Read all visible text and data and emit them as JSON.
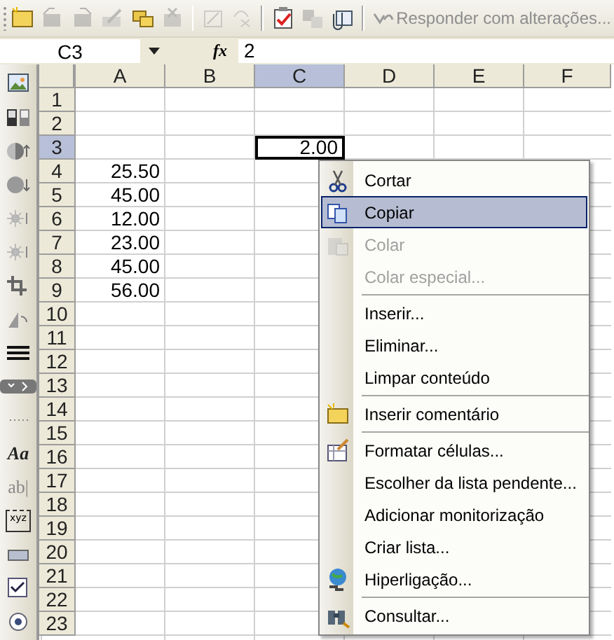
{
  "toolbar": {
    "items": [
      {
        "kind": "new-comment",
        "disabled": false
      },
      {
        "kind": "previous",
        "disabled": true
      },
      {
        "kind": "next",
        "disabled": true
      },
      {
        "kind": "edit",
        "disabled": true
      },
      {
        "kind": "show-all",
        "disabled": false
      },
      {
        "kind": "delete",
        "disabled": true
      },
      {
        "kind": "separator"
      },
      {
        "kind": "ink",
        "disabled": true
      },
      {
        "kind": "delete-ink",
        "disabled": true
      },
      {
        "kind": "separator"
      },
      {
        "kind": "track",
        "disabled": false
      },
      {
        "kind": "pages",
        "disabled": true
      },
      {
        "kind": "mail",
        "disabled": false
      },
      {
        "kind": "separator"
      }
    ],
    "reply_button": {
      "label": "Responder com alterações...",
      "disabled": true
    }
  },
  "formula_bar": {
    "name_box": "C3",
    "fx": "fx",
    "value": "2"
  },
  "side_toolbar": [
    {
      "kind": "picture"
    },
    {
      "kind": "bars"
    },
    {
      "kind": "circle-up"
    },
    {
      "kind": "circle-down"
    },
    {
      "kind": "sun-up"
    },
    {
      "kind": "sun-down"
    },
    {
      "kind": "crop"
    },
    {
      "kind": "triangle"
    },
    {
      "kind": "lines"
    },
    {
      "kind": "handle"
    },
    {
      "kind": "grip"
    },
    {
      "kind": "label",
      "label": "Aa"
    },
    {
      "kind": "label",
      "label": "ab|"
    },
    {
      "kind": "frame",
      "label": "xyz"
    },
    {
      "kind": "button"
    },
    {
      "kind": "checkbox"
    },
    {
      "kind": "radio"
    }
  ],
  "sheet": {
    "columns": [
      {
        "label": "A",
        "selected": false
      },
      {
        "label": "B",
        "selected": false
      },
      {
        "label": "C",
        "selected": true
      },
      {
        "label": "D",
        "selected": false
      },
      {
        "label": "E",
        "selected": false
      },
      {
        "label": "F",
        "selected": false
      }
    ],
    "rows": [
      {
        "label": "1",
        "selected": false,
        "cells": [
          {},
          {},
          {},
          {},
          {},
          {}
        ]
      },
      {
        "label": "2",
        "selected": false,
        "cells": [
          {},
          {},
          {},
          {},
          {},
          {}
        ]
      },
      {
        "label": "3",
        "selected": true,
        "cells": [
          {},
          {},
          {
            "value": "2.00",
            "active": true
          },
          {},
          {},
          {}
        ]
      },
      {
        "label": "4",
        "selected": false,
        "cells": [
          {
            "value": "25.50"
          },
          {},
          {},
          {},
          {},
          {}
        ]
      },
      {
        "label": "5",
        "selected": false,
        "cells": [
          {
            "value": "45.00"
          },
          {},
          {},
          {},
          {},
          {}
        ]
      },
      {
        "label": "6",
        "selected": false,
        "cells": [
          {
            "value": "12.00"
          },
          {},
          {},
          {},
          {},
          {}
        ]
      },
      {
        "label": "7",
        "selected": false,
        "cells": [
          {
            "value": "23.00"
          },
          {},
          {},
          {},
          {},
          {}
        ]
      },
      {
        "label": "8",
        "selected": false,
        "cells": [
          {
            "value": "45.00"
          },
          {},
          {},
          {},
          {},
          {}
        ]
      },
      {
        "label": "9",
        "selected": false,
        "cells": [
          {
            "value": "56.00"
          },
          {},
          {},
          {},
          {},
          {}
        ]
      },
      {
        "label": "10",
        "selected": false,
        "cells": [
          {},
          {},
          {},
          {},
          {},
          {}
        ]
      },
      {
        "label": "11",
        "selected": false,
        "cells": [
          {},
          {},
          {},
          {},
          {},
          {}
        ]
      },
      {
        "label": "12",
        "selected": false,
        "cells": [
          {},
          {},
          {},
          {},
          {},
          {}
        ]
      },
      {
        "label": "13",
        "selected": false,
        "cells": [
          {},
          {},
          {},
          {},
          {},
          {}
        ]
      },
      {
        "label": "14",
        "selected": false,
        "cells": [
          {},
          {},
          {},
          {},
          {},
          {}
        ]
      },
      {
        "label": "15",
        "selected": false,
        "cells": [
          {},
          {},
          {},
          {},
          {},
          {}
        ]
      },
      {
        "label": "16",
        "selected": false,
        "cells": [
          {},
          {},
          {},
          {},
          {},
          {}
        ]
      },
      {
        "label": "17",
        "selected": false,
        "cells": [
          {},
          {},
          {},
          {},
          {},
          {}
        ]
      },
      {
        "label": "18",
        "selected": false,
        "cells": [
          {},
          {},
          {},
          {},
          {},
          {}
        ]
      },
      {
        "label": "19",
        "selected": false,
        "cells": [
          {},
          {},
          {},
          {},
          {},
          {}
        ]
      },
      {
        "label": "20",
        "selected": false,
        "cells": [
          {},
          {},
          {},
          {},
          {},
          {}
        ]
      },
      {
        "label": "21",
        "selected": false,
        "cells": [
          {},
          {},
          {},
          {},
          {},
          {}
        ]
      },
      {
        "label": "22",
        "selected": false,
        "cells": [
          {},
          {},
          {},
          {},
          {},
          {}
        ]
      },
      {
        "label": "23",
        "selected": false,
        "cells": [
          {},
          {},
          {},
          {},
          {},
          {}
        ]
      }
    ]
  },
  "context_menu": [
    {
      "kind": "cut",
      "label": "Cortar",
      "disabled": false,
      "selected": false
    },
    {
      "kind": "copy",
      "label": "Copiar",
      "disabled": false,
      "selected": true
    },
    {
      "kind": "paste",
      "label": "Colar",
      "disabled": true,
      "selected": false
    },
    {
      "kind": "plain",
      "label": "Colar especial...",
      "disabled": true,
      "selected": false
    },
    {
      "kind": "separator"
    },
    {
      "kind": "plain",
      "label": "Inserir...",
      "disabled": false,
      "selected": false
    },
    {
      "kind": "plain",
      "label": "Eliminar...",
      "disabled": false,
      "selected": false
    },
    {
      "kind": "plain",
      "label": "Limpar conteúdo",
      "disabled": false,
      "selected": false
    },
    {
      "kind": "separator"
    },
    {
      "kind": "comment",
      "label": "Inserir comentário",
      "disabled": false,
      "selected": false
    },
    {
      "kind": "separator"
    },
    {
      "kind": "format",
      "label": "Formatar células...",
      "disabled": false,
      "selected": false
    },
    {
      "kind": "plain",
      "label": "Escolher da lista pendente...",
      "disabled": false,
      "selected": false
    },
    {
      "kind": "plain",
      "label": "Adicionar monitorização",
      "disabled": false,
      "selected": false
    },
    {
      "kind": "plain",
      "label": "Criar lista...",
      "disabled": false,
      "selected": false
    },
    {
      "kind": "link",
      "label": "Hiperligação...",
      "disabled": false,
      "selected": false
    },
    {
      "kind": "separator"
    },
    {
      "kind": "lookup",
      "label": "Consultar...",
      "disabled": false,
      "selected": false
    }
  ]
}
